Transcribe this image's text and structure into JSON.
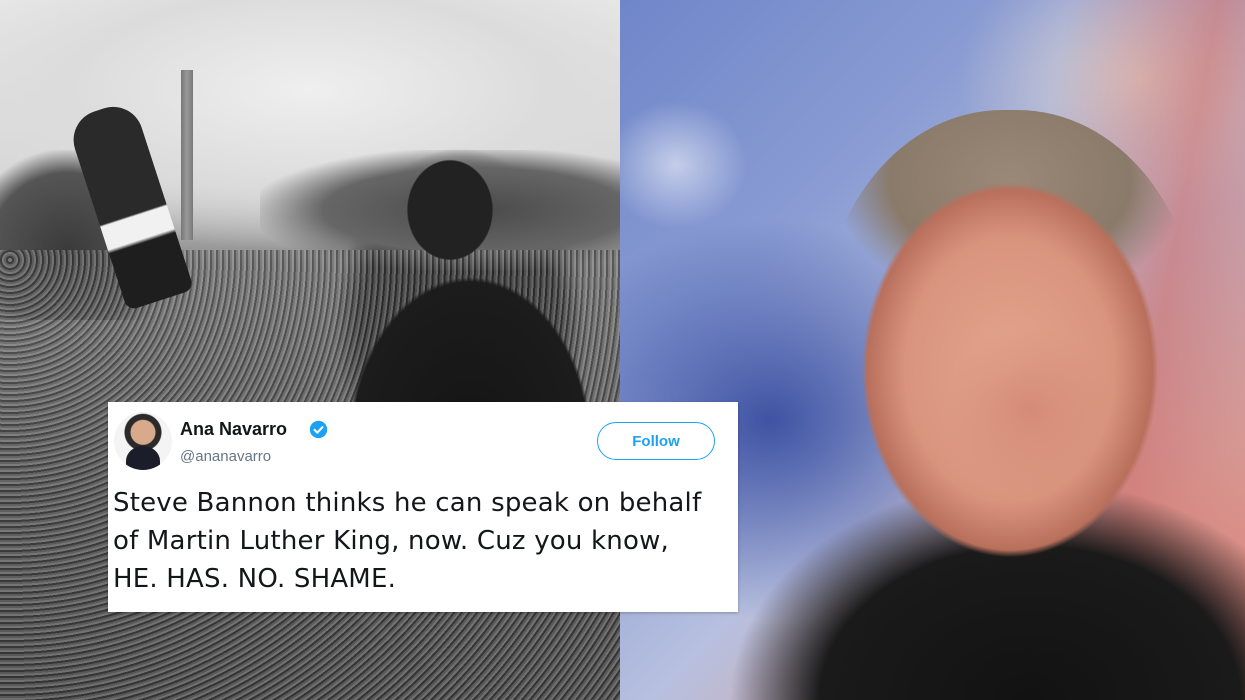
{
  "tweet": {
    "display_name": "Ana Navarro",
    "handle": "@ananavarro",
    "follow_label": "Follow",
    "verified_icon": "verified-badge-icon",
    "text_lines": [
      "Steve Bannon thinks he can speak on behalf",
      "of Martin Luther King, now. Cuz you know,",
      "HE. HAS. NO. SHAME."
    ],
    "accent_color": "#1da1f2"
  }
}
